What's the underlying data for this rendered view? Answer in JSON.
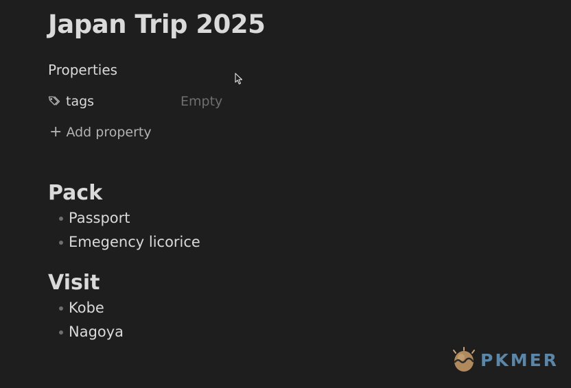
{
  "note": {
    "title": "Japan Trip 2025"
  },
  "properties": {
    "heading": "Properties",
    "items": [
      {
        "key": "tags",
        "value": "Empty",
        "icon": "tags-icon"
      }
    ],
    "add_label": "Add property"
  },
  "sections": [
    {
      "heading": "Pack",
      "items": [
        "Passport",
        "Emegency licorice"
      ]
    },
    {
      "heading": "Visit",
      "items": [
        "Kobe",
        "Nagoya"
      ]
    }
  ],
  "watermark": {
    "text": "PKMER"
  },
  "colors": {
    "background": "#1e1e1e",
    "text": "#dadada",
    "muted": "#6f6f6f",
    "watermark": "#5b86a8"
  }
}
